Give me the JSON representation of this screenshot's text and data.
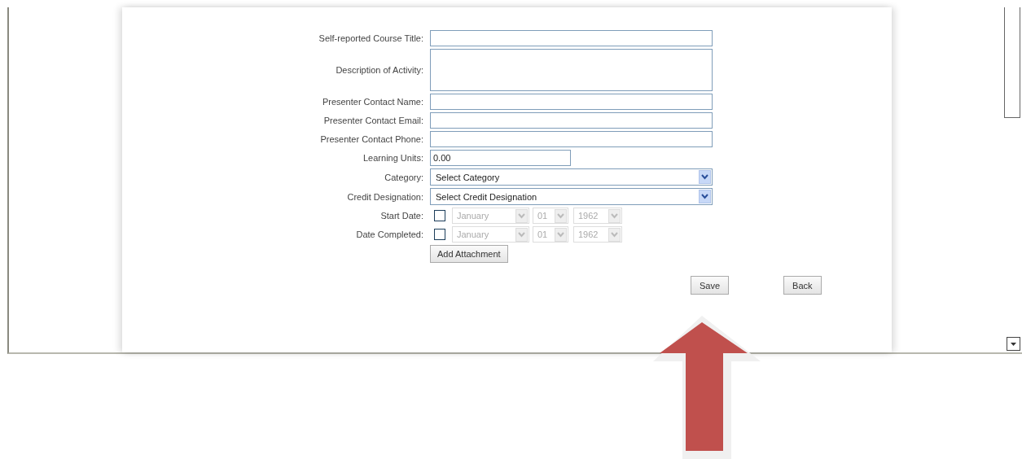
{
  "form": {
    "fields": [
      {
        "kind": "text",
        "label": "Self-reported Course Title:"
      },
      {
        "kind": "textarea",
        "label": "Description of Activity:"
      },
      {
        "kind": "text",
        "label": "Presenter Contact Name:"
      },
      {
        "kind": "text",
        "label": "Presenter Contact Email:"
      },
      {
        "kind": "text",
        "label": "Presenter Contact Phone:"
      },
      {
        "kind": "number",
        "label": "Learning Units:",
        "value": "0.00"
      },
      {
        "kind": "select",
        "label": "Category:",
        "value": "Select Category"
      },
      {
        "kind": "select",
        "label": "Credit Designation:",
        "value": "Select Credit Designation"
      },
      {
        "kind": "date",
        "label": "Start Date:",
        "checked": false,
        "disabled": true,
        "month": "January",
        "day": "01",
        "year": "1962"
      },
      {
        "kind": "date",
        "label": "Date Completed:",
        "checked": false,
        "disabled": true,
        "month": "January",
        "day": "01",
        "year": "1962"
      }
    ],
    "attachment_button": "Add Attachment",
    "buttons": [
      "Save",
      "Back"
    ]
  }
}
